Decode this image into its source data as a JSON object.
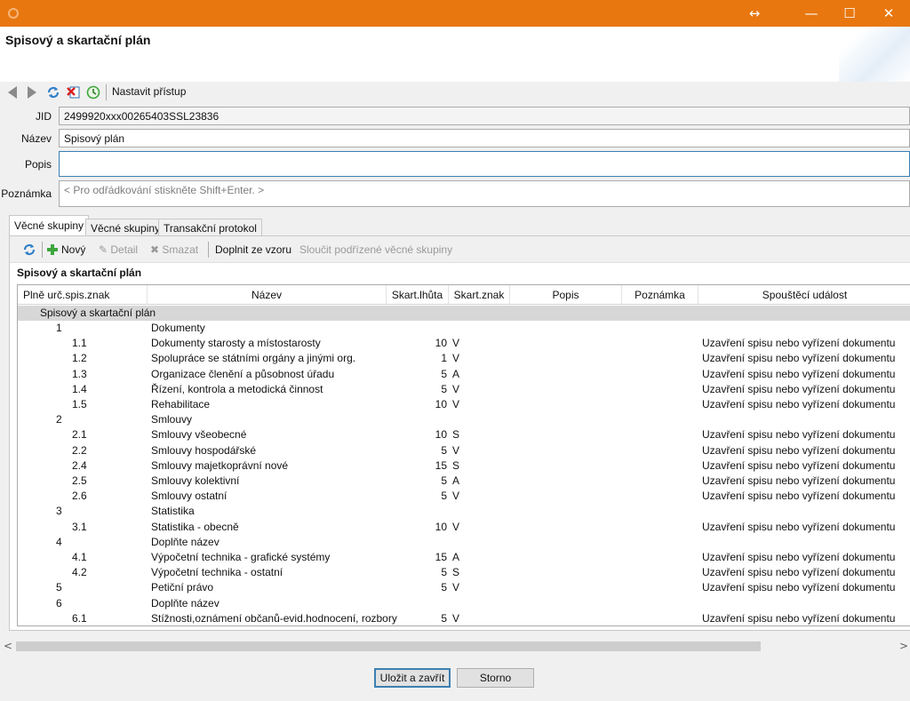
{
  "window": {
    "resize_glyph": "↔",
    "minimize_glyph": "—",
    "maximize_glyph": "☐",
    "close_glyph": "✕"
  },
  "header": {
    "title": "Spisový a skartační plán"
  },
  "toolbar": {
    "set_access_label": "Nastavit přístup"
  },
  "form": {
    "jid_label": "JID",
    "jid_value": "2499920xxx00265403SSL23836",
    "name_label": "Název",
    "name_value": "Spisový plán",
    "description_label": "Popis",
    "description_value": "",
    "note_label": "Poznámka",
    "note_placeholder": "< Pro odřádkování stiskněte Shift+Enter. >"
  },
  "tabs": [
    "Věcné skupiny",
    "Věcné skupiny",
    "Transakční protokol"
  ],
  "subtoolbar": {
    "new_label": "Nový",
    "detail_label": "Detail",
    "delete_label": "Smazat",
    "fill_from_template_label": "Doplnit ze vzoru",
    "merge_label": "Sloučit podřízené věcné skupiny"
  },
  "section_title": "Spisový a skartační plán",
  "table": {
    "columns": [
      "Plně urč.spis.znak",
      "Název",
      "Skart.lhůta",
      "Skart.znak",
      "Popis",
      "Poznámka",
      "Spouštěcí událost"
    ],
    "group_label": "Spisový a skartační plán",
    "rows": [
      {
        "code": "1",
        "level": 1,
        "name": "Dokumenty",
        "period": "",
        "sign": "",
        "event": ""
      },
      {
        "code": "1.1",
        "level": 2,
        "name": "Dokumenty starosty a místostarosty",
        "period": "10",
        "sign": "V",
        "event": "Uzavření spisu nebo vyřízení dokumentu"
      },
      {
        "code": "1.2",
        "level": 2,
        "name": "Spolupráce se státními orgány a jinými org.",
        "period": "1",
        "sign": "V",
        "event": "Uzavření spisu nebo vyřízení dokumentu"
      },
      {
        "code": "1.3",
        "level": 2,
        "name": "Organizace členění a působnost úřadu",
        "period": "5",
        "sign": "A",
        "event": "Uzavření spisu nebo vyřízení dokumentu"
      },
      {
        "code": "1.4",
        "level": 2,
        "name": "Řízení, kontrola a metodická činnost",
        "period": "5",
        "sign": "V",
        "event": "Uzavření spisu nebo vyřízení dokumentu"
      },
      {
        "code": "1.5",
        "level": 2,
        "name": "Rehabilitace",
        "period": "10",
        "sign": "V",
        "event": "Uzavření spisu nebo vyřízení dokumentu"
      },
      {
        "code": "2",
        "level": 1,
        "name": "Smlouvy",
        "period": "",
        "sign": "",
        "event": ""
      },
      {
        "code": "2.1",
        "level": 2,
        "name": "Smlouvy všeobecné",
        "period": "10",
        "sign": "S",
        "event": "Uzavření spisu nebo vyřízení dokumentu"
      },
      {
        "code": "2.2",
        "level": 2,
        "name": "Smlouvy hospodářské",
        "period": "5",
        "sign": "V",
        "event": "Uzavření spisu nebo vyřízení dokumentu"
      },
      {
        "code": "2.4",
        "level": 2,
        "name": "Smlouvy majetkoprávní nové",
        "period": "15",
        "sign": "S",
        "event": "Uzavření spisu nebo vyřízení dokumentu"
      },
      {
        "code": "2.5",
        "level": 2,
        "name": "Smlouvy kolektivní",
        "period": "5",
        "sign": "A",
        "event": "Uzavření spisu nebo vyřízení dokumentu"
      },
      {
        "code": "2.6",
        "level": 2,
        "name": "Smlouvy ostatní",
        "period": "5",
        "sign": "V",
        "event": "Uzavření spisu nebo vyřízení dokumentu"
      },
      {
        "code": "3",
        "level": 1,
        "name": "Statistika",
        "period": "",
        "sign": "",
        "event": ""
      },
      {
        "code": "3.1",
        "level": 2,
        "name": "Statistika - obecně",
        "period": "10",
        "sign": "V",
        "event": "Uzavření spisu nebo vyřízení dokumentu"
      },
      {
        "code": "4",
        "level": 1,
        "name": "Doplňte název",
        "period": "",
        "sign": "",
        "event": ""
      },
      {
        "code": "4.1",
        "level": 2,
        "name": "Výpočetní technika - grafické systémy",
        "period": "15",
        "sign": "A",
        "event": "Uzavření spisu nebo vyřízení dokumentu"
      },
      {
        "code": "4.2",
        "level": 2,
        "name": "Výpočetní technika - ostatní",
        "period": "5",
        "sign": "S",
        "event": "Uzavření spisu nebo vyřízení dokumentu"
      },
      {
        "code": "5",
        "level": 1,
        "name": "Petiční právo",
        "period": "5",
        "sign": "V",
        "event": "Uzavření spisu nebo vyřízení dokumentu"
      },
      {
        "code": "6",
        "level": 1,
        "name": "Doplňte název",
        "period": "",
        "sign": "",
        "event": ""
      },
      {
        "code": "6.1",
        "level": 2,
        "name": "Stížnosti,oznámení občanů-evid.hodnocení, rozbory",
        "period": "5",
        "sign": "V",
        "event": "Uzavření spisu nebo vyřízení dokumentu"
      }
    ]
  },
  "scroll": {
    "left_arrow": "<",
    "right_arrow": ">"
  },
  "footer": {
    "save_close_label": "Uložit a zavřít",
    "cancel_label": "Storno"
  },
  "colors": {
    "titlebar": "#e8770f",
    "focus": "#3c7fb1",
    "group_row": "#d7d7d7"
  },
  "icons": [
    "back-icon",
    "forward-icon",
    "refresh-icon",
    "delete-icon",
    "history-icon",
    "add-icon",
    "detail-icon"
  ]
}
